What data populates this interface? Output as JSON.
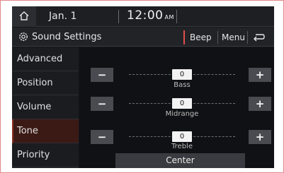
{
  "status_bar": {
    "date": "Jan. 1",
    "time": "12:00",
    "ampm": "AM"
  },
  "header": {
    "title": "Sound Settings",
    "beep_label": "Beep",
    "menu_label": "Menu"
  },
  "sidebar": {
    "items": [
      {
        "label": "Advanced",
        "active": false
      },
      {
        "label": "Position",
        "active": false
      },
      {
        "label": "Volume",
        "active": false
      },
      {
        "label": "Tone",
        "active": true
      },
      {
        "label": "Priority",
        "active": false
      }
    ]
  },
  "tone": {
    "minus_label": "−",
    "plus_label": "+",
    "controls": [
      {
        "name": "Bass",
        "value": "0",
        "level": 0
      },
      {
        "name": "Midrange",
        "value": "0",
        "level": 0
      },
      {
        "name": "Treble",
        "value": "0",
        "level": 0
      }
    ],
    "center_label": "Center"
  },
  "colors": {
    "accent": "#e0504a",
    "active_tab": "#3b1a16",
    "background": "#15161a"
  }
}
